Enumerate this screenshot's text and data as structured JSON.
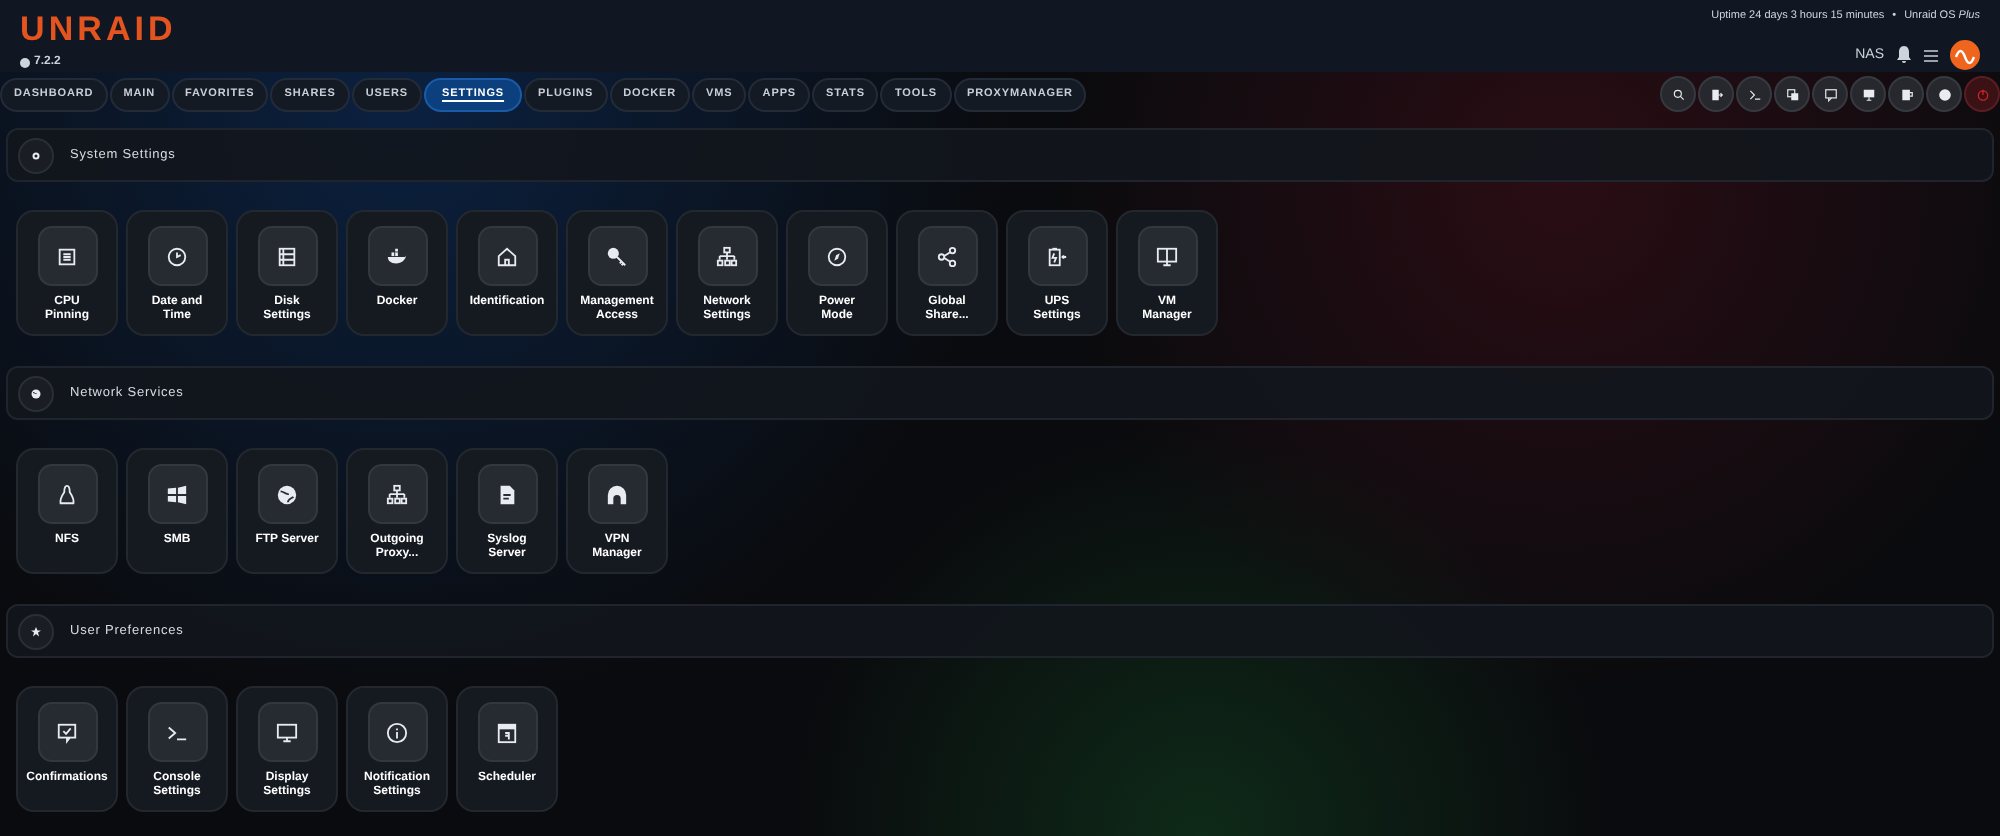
{
  "header": {
    "logo": "UNRAID",
    "version": "7.2.2",
    "uptime": "Uptime 24 days 3 hours 15 minutes",
    "separator": "•",
    "license": "Unraid OS *Plus*",
    "server_name": "NAS"
  },
  "tabs": [
    {
      "label": "DASHBOARD",
      "selected": false
    },
    {
      "label": "MAIN",
      "selected": false
    },
    {
      "label": "FAVORITES",
      "selected": false
    },
    {
      "label": "SHARES",
      "selected": false
    },
    {
      "label": "USERS",
      "selected": false
    },
    {
      "label": "SETTINGS",
      "selected": true
    },
    {
      "label": "PLUGINS",
      "selected": false
    },
    {
      "label": "DOCKER",
      "selected": false
    },
    {
      "label": "VMS",
      "selected": false
    },
    {
      "label": "APPS",
      "selected": false
    },
    {
      "label": "STATS",
      "selected": false
    },
    {
      "label": "TOOLS",
      "selected": false
    },
    {
      "label": "PROXYMANAGER",
      "selected": false
    }
  ],
  "sections": [
    {
      "title": "System Settings",
      "items": [
        "CPU\nPinning",
        "Date and\nTime",
        "Disk\nSettings",
        "Docker",
        "Identification",
        "Management\nAccess",
        "Network\nSettings",
        "Power\nMode",
        "Global\nShare...",
        "UPS\nSettings",
        "VM\nManager"
      ]
    },
    {
      "title": "Network Services",
      "items": [
        "NFS",
        "SMB",
        "FTP Server",
        "Outgoing\nProxy...",
        "Syslog\nServer",
        "VPN\nManager"
      ]
    },
    {
      "title": "User Preferences",
      "items": [
        "Confirmations",
        "Console\nSettings",
        "Display\nSettings",
        "Notification\nSettings",
        "Scheduler"
      ]
    }
  ]
}
